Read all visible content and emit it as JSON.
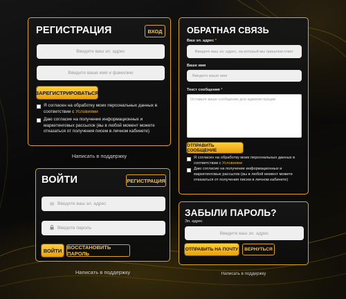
{
  "register": {
    "title": "РЕГИСТРАЦИЯ",
    "login_link": "ВХОД",
    "email_placeholder": "Введите ваш эл. адрес",
    "name_placeholder": "Введите ваше имя и фамилию",
    "submit_label": "ЗАРЕГИСТРИРОВАТЬСЯ",
    "consent1_text": "Я согласен на обработку моих персональных данных в соответствии с ",
    "consent1_link": "Условиями",
    "consent2_text": "Даю согласие на получение информационных и маркетинговых рассылок (вы в любой момент можете отказаться от получения писем в личном кабинете)",
    "support_link": "Написать в поддержку"
  },
  "login": {
    "title": "ВОЙТИ",
    "register_link": "РЕГИСТРАЦИЯ",
    "email_placeholder": "Введите ваш эл. адрес",
    "password_placeholder": "Введите пароль",
    "submit_label": "ВОЙТИ",
    "restore_label": "ВОССТАНОВИТЬ ПАРОЛЬ",
    "support_link": "Написать в поддержку"
  },
  "feedback": {
    "title": "ОБРАТНАЯ СВЯЗЬ",
    "email_label": "Ваш эл. адрес",
    "email_placeholder": "Введите ваш эл. адрес, на который мы пришлем ответ",
    "name_label": "Ваше имя",
    "name_placeholder": "Введите ваше имя",
    "message_label": "Текст сообщения",
    "message_placeholder": "Оставьте ваше сообщение для администрации",
    "submit_label": "ОТПРАВИТЬ СООБЩЕНИЕ",
    "consent1_text": "Я согласен на обработку моих персональных данных в соответствии с ",
    "consent1_link": "Условиями",
    "consent2_text": "Даю согласие на получение информационных и маркетинговых рассылок (вы в любой момент можете отказаться от получения писем в личном кабинете)",
    "required_mark": "*"
  },
  "forgot": {
    "title": "ЗАБЫЛИ ПАРОЛЬ?",
    "email_label": "Эл. адрес",
    "email_placeholder": "Введите ваш эл. адрес",
    "submit_label": "ОТПРАВИТЬ НА ПОЧТУ",
    "back_label": "ВЕРНУТЬСЯ",
    "support_link": "Написать в поддержку"
  },
  "icons": {
    "email": "envelope-icon",
    "password": "lock-icon"
  },
  "colors": {
    "accent": "#e0a425",
    "button_gold": "#ffc83a",
    "background": "#0b0b0b"
  }
}
